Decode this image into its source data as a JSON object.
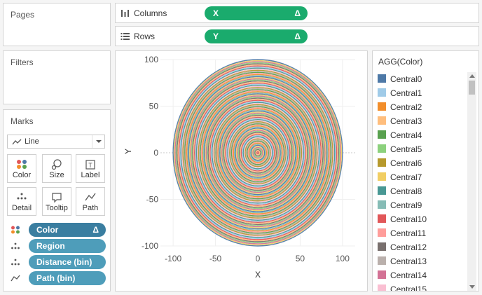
{
  "pages": {
    "title": "Pages"
  },
  "filters": {
    "title": "Filters"
  },
  "columns": {
    "label": "Columns",
    "pill": "X",
    "pill_delta": "Δ"
  },
  "rows": {
    "label": "Rows",
    "pill": "Y",
    "pill_delta": "Δ"
  },
  "marks": {
    "title": "Marks",
    "mark_type": "Line",
    "buttons": [
      {
        "label": "Color",
        "icon": "color-dots-icon"
      },
      {
        "label": "Size",
        "icon": "size-icon"
      },
      {
        "label": "Label",
        "icon": "label-icon"
      },
      {
        "label": "Detail",
        "icon": "detail-icon"
      },
      {
        "label": "Tooltip",
        "icon": "tooltip-icon"
      },
      {
        "label": "Path",
        "icon": "path-icon"
      }
    ],
    "pills": [
      {
        "label": "Color",
        "icon": "color-dots-icon",
        "delta": "Δ"
      },
      {
        "label": "Region",
        "icon": "detail-icon"
      },
      {
        "label": "Distance (bin)",
        "icon": "detail-icon"
      },
      {
        "label": "Path (bin)",
        "icon": "path-icon"
      }
    ]
  },
  "legend": {
    "title": "AGG(Color)",
    "items": [
      {
        "label": "Central0",
        "color": "#4e79a7"
      },
      {
        "label": "Central1",
        "color": "#a0cbe8"
      },
      {
        "label": "Central2",
        "color": "#f28e2b"
      },
      {
        "label": "Central3",
        "color": "#ffbe7d"
      },
      {
        "label": "Central4",
        "color": "#59a14f"
      },
      {
        "label": "Central5",
        "color": "#8cd17d"
      },
      {
        "label": "Central6",
        "color": "#b6992d"
      },
      {
        "label": "Central7",
        "color": "#f1ce63"
      },
      {
        "label": "Central8",
        "color": "#499894"
      },
      {
        "label": "Central9",
        "color": "#86bcb6"
      },
      {
        "label": "Central10",
        "color": "#e15759"
      },
      {
        "label": "Central11",
        "color": "#ff9d9a"
      },
      {
        "label": "Central12",
        "color": "#79706e"
      },
      {
        "label": "Central13",
        "color": "#bab0ac"
      },
      {
        "label": "Central14",
        "color": "#d37295"
      },
      {
        "label": "Central15",
        "color": "#fabfd2"
      }
    ]
  },
  "chart_data": {
    "type": "line",
    "xlabel": "X",
    "ylabel": "Y",
    "xlim": [
      -115,
      115
    ],
    "ylim": [
      -100,
      100
    ],
    "x_ticks": [
      -100,
      -50,
      0,
      50,
      100
    ],
    "y_ticks": [
      100,
      50,
      0,
      -50,
      -100
    ],
    "grid": true,
    "shape": "concentric circles centred at (0, 0)",
    "ring_radius_range": [
      0,
      100
    ],
    "ring_colors": [
      "#4e79a7",
      "#a0cbe8",
      "#f28e2b",
      "#ffbe7d",
      "#59a14f",
      "#8cd17d",
      "#b6992d",
      "#f1ce63",
      "#499894",
      "#86bcb6",
      "#e15759",
      "#ff9d9a",
      "#79706e",
      "#bab0ac",
      "#d37295",
      "#fabfd2"
    ]
  }
}
